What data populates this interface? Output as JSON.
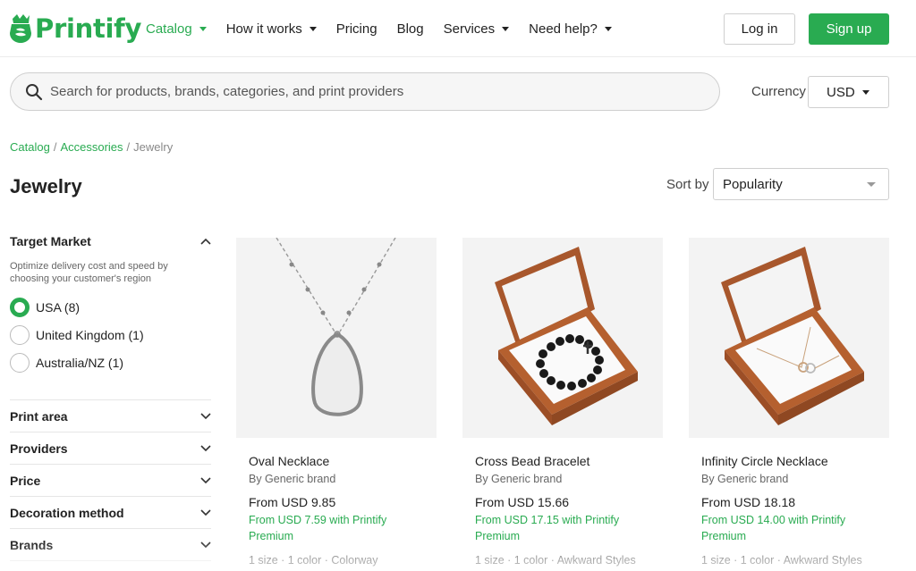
{
  "brand": {
    "name": "Printify",
    "color": "#29ab51"
  },
  "nav": {
    "items": [
      {
        "label": "Catalog",
        "dropdown": true,
        "active": true
      },
      {
        "label": "How it works",
        "dropdown": true,
        "active": false
      },
      {
        "label": "Pricing",
        "dropdown": false,
        "active": false
      },
      {
        "label": "Blog",
        "dropdown": false,
        "active": false
      },
      {
        "label": "Services",
        "dropdown": true,
        "active": false
      },
      {
        "label": "Need help?",
        "dropdown": true,
        "active": false
      }
    ],
    "login_label": "Log in",
    "signup_label": "Sign up"
  },
  "search": {
    "placeholder": "Search for products, brands, categories, and print providers",
    "value": ""
  },
  "currency": {
    "label": "Currency",
    "value": "USD"
  },
  "breadcrumb": {
    "items": [
      "Catalog",
      "Accessories",
      "Jewelry"
    ]
  },
  "page_title": "Jewelry",
  "sort": {
    "label": "Sort by",
    "value": "Popularity"
  },
  "sidebar": {
    "target_market": {
      "title": "Target Market",
      "description": "Optimize delivery cost and speed by choosing your customer's region",
      "options": [
        {
          "label": "USA (8)",
          "checked": true
        },
        {
          "label": "United Kingdom (1)",
          "checked": false
        },
        {
          "label": "Australia/NZ (1)",
          "checked": false
        }
      ]
    },
    "filters": [
      "Print area",
      "Providers",
      "Price",
      "Decoration method",
      "Brands"
    ]
  },
  "products": [
    {
      "title": "Oval Necklace",
      "brand": "By Generic brand",
      "price": "From USD 9.85",
      "premium": "From USD 7.59 with Printify Premium",
      "meta": "1 size · 1 color · Colorway",
      "image": "oval-necklace"
    },
    {
      "title": "Cross Bead Bracelet",
      "brand": "By Generic brand",
      "price": "From USD 15.66",
      "premium": "From USD 17.15 with Printify Premium",
      "meta": "1 size · 1 color · Awkward Styles",
      "image": "bracelet-box"
    },
    {
      "title": "Infinity Circle Necklace",
      "brand": "By Generic brand",
      "price": "From USD 18.18",
      "premium": "From USD 14.00 with Printify Premium",
      "meta": "1 size · 1 color · Awkward Styles",
      "image": "necklace-box"
    }
  ]
}
